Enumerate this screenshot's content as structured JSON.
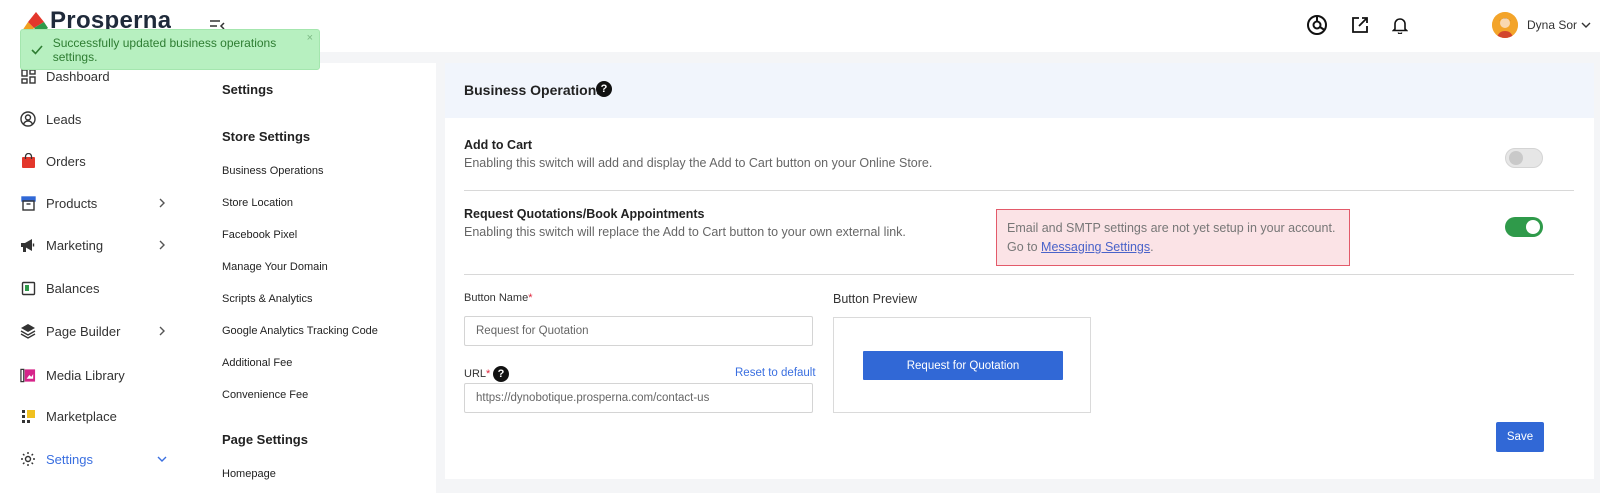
{
  "app": {
    "logo_text": "Prosperna"
  },
  "toast": {
    "message": "Successfully updated business operations settings.",
    "close": "×"
  },
  "sidebar": {
    "items": [
      {
        "label": "Dashboard"
      },
      {
        "label": "Leads"
      },
      {
        "label": "Orders"
      },
      {
        "label": "Products"
      },
      {
        "label": "Marketing"
      },
      {
        "label": "Balances"
      },
      {
        "label": "Page Builder"
      },
      {
        "label": "Media Library"
      },
      {
        "label": "Marketplace"
      },
      {
        "label": "Settings"
      }
    ]
  },
  "topbar": {
    "user_name": "Dyna Sor"
  },
  "settings_nav": {
    "title": "Settings",
    "store_section": "Store Settings",
    "store_links": [
      "Business Operations",
      "Store Location",
      "Facebook Pixel",
      "Manage Your Domain",
      "Scripts & Analytics",
      "Google Analytics Tracking Code",
      "Additional Fee",
      "Convenience Fee"
    ],
    "page_section": "Page Settings",
    "page_links": [
      "Homepage"
    ]
  },
  "main": {
    "title": "Business Operations",
    "help": "?",
    "add_to_cart": {
      "title": "Add to Cart",
      "description": "Enabling this switch will add and display the Add to Cart button on your Online Store.",
      "enabled": false
    },
    "request_quotation": {
      "title": "Request Quotations/Book Appointments",
      "description": "Enabling this switch will replace the Add to Cart button to your own external link.",
      "enabled": true
    },
    "alert": {
      "line1": "Email and SMTP settings are not yet setup in your account.",
      "line2_prefix": "Go to ",
      "link": "Messaging Settings",
      "line2_suffix": "."
    },
    "button_name": {
      "label": "Button Name",
      "required": "*",
      "value": "Request for Quotation"
    },
    "url": {
      "label": "URL",
      "required": "*",
      "value": "https://dynobotique.prosperna.com/contact-us",
      "reset": "Reset to default"
    },
    "preview": {
      "label": "Button Preview",
      "button": "Request for Quotation"
    },
    "save": "Save"
  },
  "colors": {
    "accent": "#3168d6",
    "toggle_on": "#2f9a4a",
    "toast_bg": "#b7f0c0",
    "alert_bg": "#fbe3e6",
    "alert_border": "#e35a6a"
  }
}
